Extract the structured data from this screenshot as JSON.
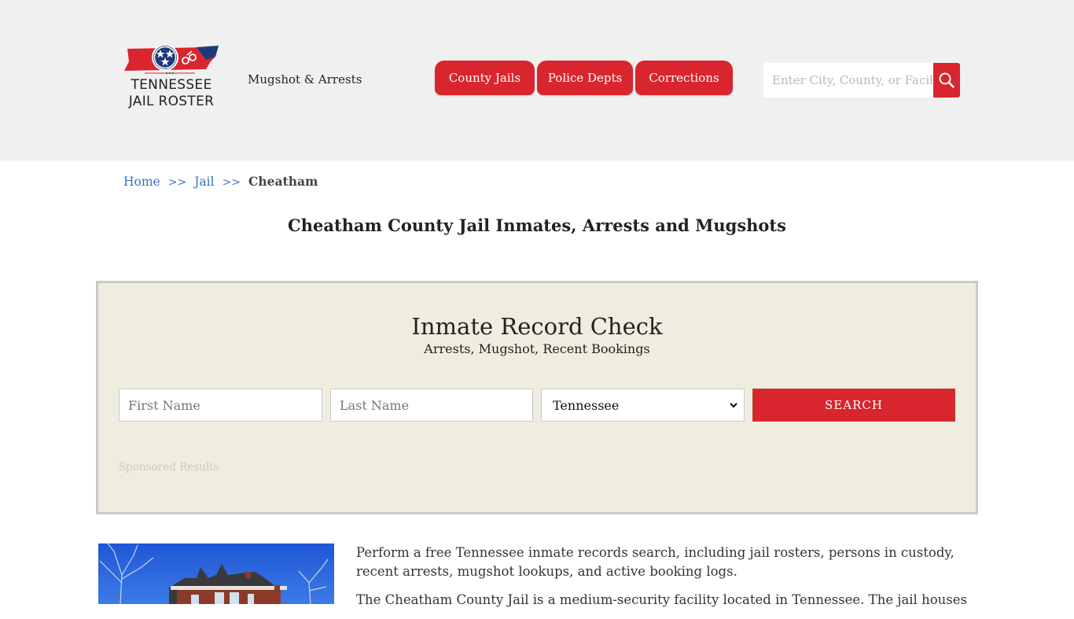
{
  "header": {
    "logo": {
      "line1": "TENNESSEE",
      "line2": "JAIL ROSTER",
      "colors": {
        "red": "#d9252e",
        "blue": "#1c3b7a"
      }
    },
    "tagline": "Mugshot & Arrests",
    "nav": [
      {
        "label": "County Jails"
      },
      {
        "label": "Police Depts"
      },
      {
        "label": "Corrections"
      }
    ],
    "search": {
      "placeholder": "Enter City, County, or Facility",
      "value": "",
      "icon": "magnifier-icon"
    }
  },
  "breadcrumb": {
    "items": [
      "Home",
      "Jail"
    ],
    "separator": ">>",
    "current": "Cheatham"
  },
  "page_title": "Cheatham County Jail Inmates, Arrests and Mugshots",
  "record_check": {
    "title": "Inmate Record Check",
    "subtitle": "Arrests, Mugshot, Recent Bookings",
    "first_name_placeholder": "First Name",
    "last_name_placeholder": "Last Name",
    "state_selected": "Tennessee",
    "search_label": "SEARCH",
    "sponsored_label": "Sponsored Results"
  },
  "intro": {
    "paragraph1": "Perform a free Tennessee inmate records search, including jail rosters, persons in custody, recent arrests, mugshot lookups, and active booking logs.",
    "paragraph2": "The Cheatham County Jail is a medium-security facility located in Tennessee. The jail houses adults"
  },
  "colors": {
    "accent": "#d9252e",
    "link": "#3a70c9",
    "header_bg": "#f0f0f0",
    "box_bg": "#efede0"
  }
}
